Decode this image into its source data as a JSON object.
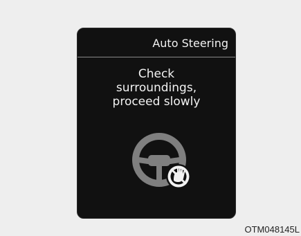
{
  "panel": {
    "title": "Auto Steering",
    "message_lines": [
      "Check",
      "surroundings,",
      "proceed slowly"
    ],
    "icons": [
      "steering-wheel-icon",
      "hands-off-prohibited-icon"
    ]
  },
  "figure_code": "OTM048145L",
  "colors": {
    "panel_background": "#111111",
    "page_background": "#eeeeee",
    "text_primary": "#f2f2f2",
    "icon_gray": "#7f7f7f",
    "divider": "#8a8a8a"
  }
}
